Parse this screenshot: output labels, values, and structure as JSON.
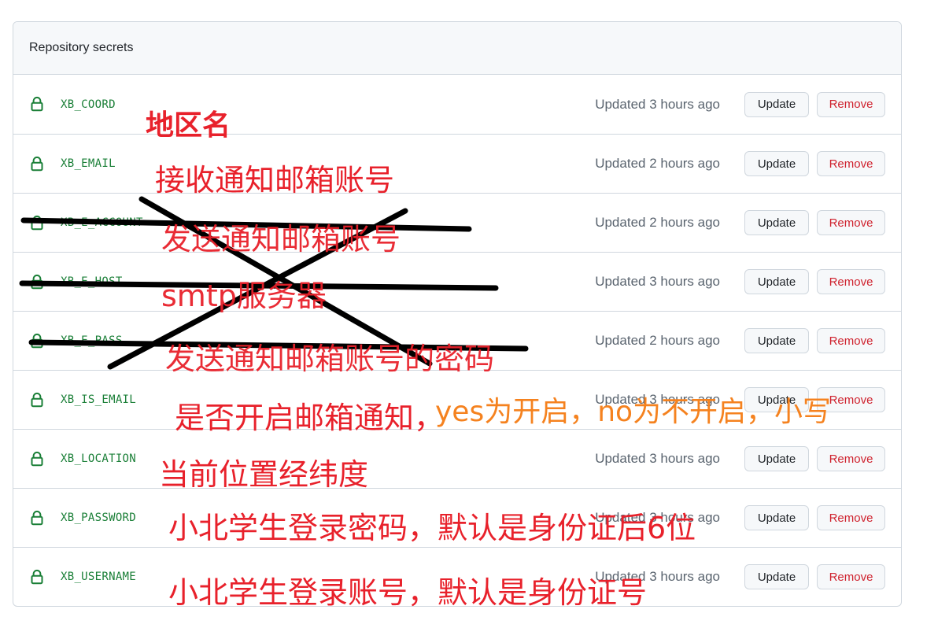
{
  "header": {
    "title": "Repository secrets"
  },
  "secrets": [
    {
      "name": "XB_COORD",
      "updated": "Updated 3 hours ago"
    },
    {
      "name": "XB_EMAIL",
      "updated": "Updated 2 hours ago"
    },
    {
      "name": "XB_E_ACCOUNT",
      "updated": "Updated 2 hours ago"
    },
    {
      "name": "XB_E_HOST",
      "updated": "Updated 3 hours ago"
    },
    {
      "name": "XB_E_PASS",
      "updated": "Updated 2 hours ago"
    },
    {
      "name": "XB_IS_EMAIL",
      "updated": "Updated 3 hours ago"
    },
    {
      "name": "XB_LOCATION",
      "updated": "Updated 3 hours ago"
    },
    {
      "name": "XB_PASSWORD",
      "updated": "Updated 3 hours ago"
    },
    {
      "name": "XB_USERNAME",
      "updated": "Updated 3 hours ago"
    }
  ],
  "buttons": {
    "update": "Update",
    "remove": "Remove"
  },
  "icons": {
    "row": "lock-icon"
  },
  "annotations": {
    "coord": "地区名",
    "email": "接收通知邮箱账号",
    "e_account": "发送通知邮箱账号",
    "e_host": "smtp服务器",
    "e_pass": "发送通知邮箱账号的密码",
    "is_email_a": "是否开启邮箱通知，",
    "is_email_b": "yes为开启，no为不开启，小写",
    "location": "当前位置经纬度",
    "password": "小北学生登录密码，默认是身份证后6位",
    "username": "小北学生登录账号，默认是身份证号"
  },
  "colors": {
    "annotation_red": "#e8212b",
    "annotation_orange": "#f5821f",
    "secret_name_green": "#1a7f37",
    "remove_red": "#cf222e",
    "lock_green": "#1a7f37"
  }
}
